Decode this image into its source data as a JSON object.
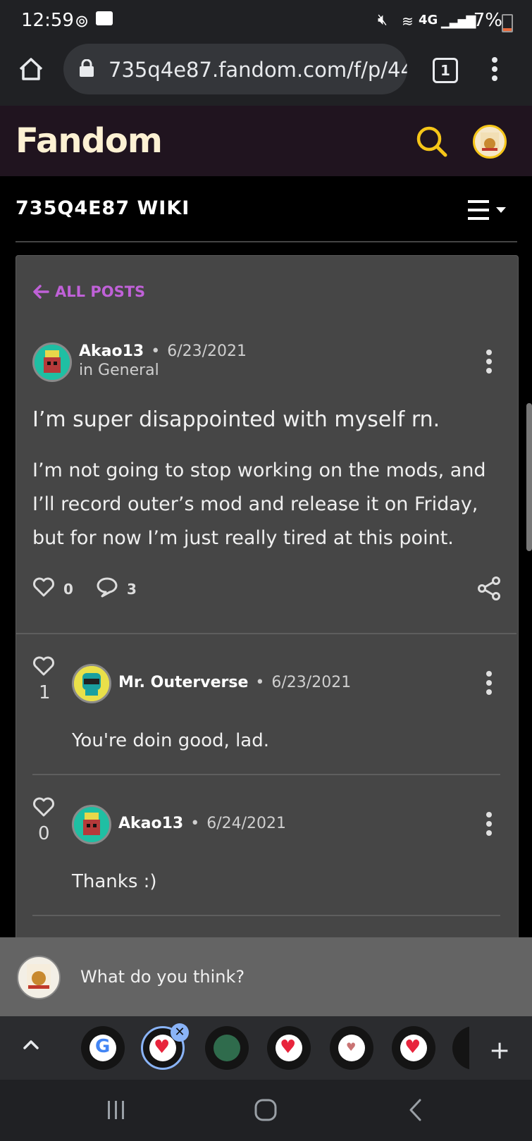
{
  "status_bar": {
    "time": "12:59",
    "battery": "7%"
  },
  "browser": {
    "url": "735q4e87.fandom.com/f/p/44",
    "tab_count": "1"
  },
  "fandom": {
    "logo": "Fandom"
  },
  "wiki": {
    "title": "735Q4E87 WIKI"
  },
  "post": {
    "back_label": "ALL POSTS",
    "author": "Akao13",
    "date": "6/23/2021",
    "category": "in General",
    "title": "I’m super disappointed with myself rn.",
    "body": "I’m not going to stop working on the mods, and I’ll record outer’s mod and release it on Friday, but for now I’m just really tired at this point.",
    "likes": "0",
    "comments": "3"
  },
  "replies": [
    {
      "likes": "1",
      "author": "Mr. Outerverse",
      "date": "6/23/2021",
      "text": "You're doin good, lad."
    },
    {
      "likes": "0",
      "author": "Akao13",
      "date": "6/24/2021",
      "text": "Thanks :)"
    }
  ],
  "reply_box": {
    "placeholder": "What do you think?"
  },
  "colors": {
    "accent": "#c061d8",
    "search": "#f5c518",
    "header_bg": "#20141f",
    "card_bg": "#464646"
  }
}
